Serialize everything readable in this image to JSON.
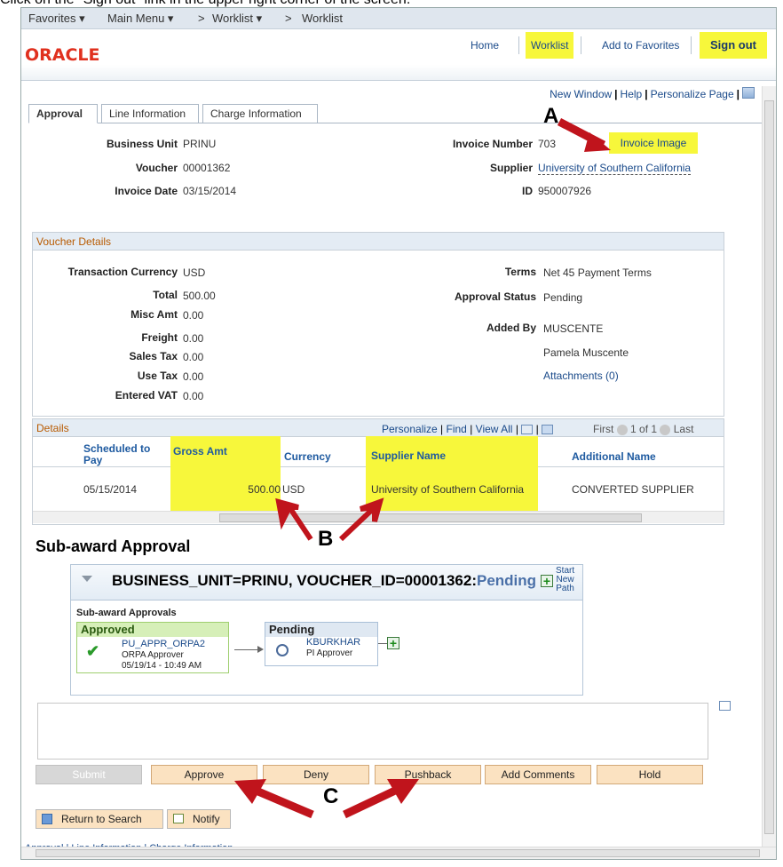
{
  "instruction": "Click on the \"Sign out\" link in the upper right corner of the screen.",
  "nav": {
    "favorites": "Favorites",
    "main_menu": "Main Menu",
    "sep": ">",
    "worklist1": "Worklist",
    "worklist2": "Worklist"
  },
  "header": {
    "brand": "ORACLE",
    "home": "Home",
    "worklist": "Worklist",
    "add_favorites": "Add to Favorites",
    "sign_out": "Sign out"
  },
  "pagelinks": {
    "new_window": "New Window",
    "help": "Help",
    "personalize_page": "Personalize Page"
  },
  "tabs": [
    "Approval",
    "Line Information",
    "Charge Information"
  ],
  "invoice": {
    "business_unit_label": "Business Unit",
    "business_unit": "PRINU",
    "voucher_label": "Voucher",
    "voucher": "00001362",
    "invoice_date_label": "Invoice Date",
    "invoice_date": "03/15/2014",
    "invoice_number_label": "Invoice Number",
    "invoice_number": "703",
    "invoice_image": "Invoice Image",
    "supplier_label": "Supplier",
    "supplier": "University of Southern California",
    "id_label": "ID",
    "id": "950007926"
  },
  "voucher_details": {
    "title": "Voucher Details",
    "transaction_currency_label": "Transaction Currency",
    "transaction_currency": "USD",
    "total_label": "Total",
    "total": "500.00",
    "misc_label": "Misc Amt",
    "misc": "0.00",
    "freight_label": "Freight",
    "freight": "0.00",
    "sales_tax_label": "Sales Tax",
    "sales_tax": "0.00",
    "use_tax_label": "Use Tax",
    "use_tax": "0.00",
    "vat_label": "Entered VAT",
    "vat": "0.00",
    "terms_label": "Terms",
    "terms": "Net 45 Payment Terms",
    "approval_status_label": "Approval Status",
    "approval_status": "Pending",
    "added_by_label": "Added By",
    "added_by": "MUSCENTE",
    "added_by_name": "Pamela Muscente",
    "attachments": "Attachments (0)"
  },
  "details": {
    "title": "Details",
    "links": {
      "personalize": "Personalize",
      "find": "Find",
      "view_all": "View All",
      "first": "First",
      "range": "1 of 1",
      "last": "Last"
    },
    "columns": [
      "Scheduled to Pay",
      "Gross Amt",
      "Currency",
      "Supplier Name",
      "Additional Name"
    ],
    "row": {
      "scheduled": "05/15/2014",
      "gross": "500.00",
      "currency": "USD",
      "supplier": "University of Southern California",
      "additional": "CONVERTED SUPPLIER"
    }
  },
  "subaward": {
    "heading": "Sub-award Approval",
    "path_title": "BUSINESS_UNIT=PRINU, VOUCHER_ID=00001362:",
    "path_status": "Pending",
    "start_new_path": [
      "Start",
      "New",
      "Path"
    ],
    "section": "Sub-award Approvals",
    "approved": {
      "status": "Approved",
      "user": "PU_APPR_ORPA2",
      "role": "ORPA Approver",
      "date": "05/19/14 - 10:49 AM"
    },
    "pending": {
      "status": "Pending",
      "user": "KBURKHAR",
      "role": "PI Approver"
    }
  },
  "buttons": {
    "submit": "Submit",
    "approve": "Approve",
    "deny": "Deny",
    "pushback": "Pushback",
    "add_comments": "Add Comments",
    "hold": "Hold"
  },
  "footer": {
    "return": "Return to Search",
    "notify": "Notify",
    "links": "Approval | Line Information | Charge Information"
  },
  "annotations": {
    "a": "A",
    "b": "B",
    "c": "C"
  }
}
